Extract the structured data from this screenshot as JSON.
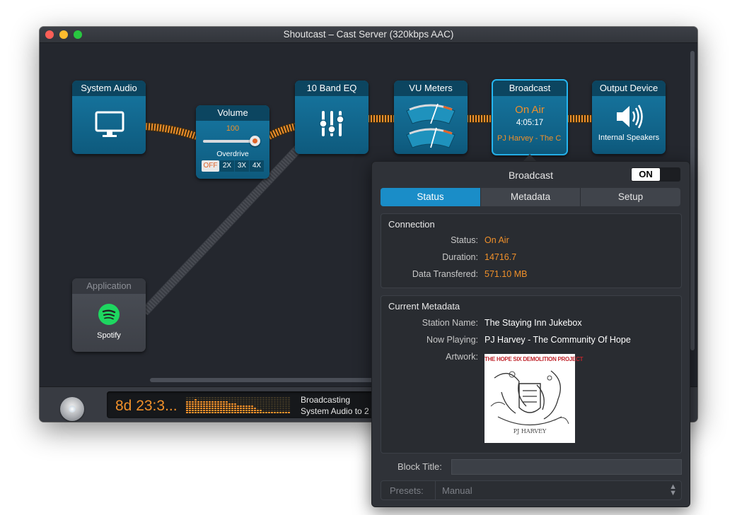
{
  "window": {
    "title": "Shoutcast – Cast Server (320kbps AAC)"
  },
  "nodes": {
    "system_audio": {
      "title": "System Audio"
    },
    "volume": {
      "title": "Volume",
      "value": "100",
      "overdrive_label": "Overdrive",
      "overdrive_options": [
        "OFF",
        "2X",
        "3X",
        "4X"
      ],
      "overdrive_selected": "OFF"
    },
    "eq": {
      "title": "10 Band EQ"
    },
    "vu": {
      "title": "VU Meters"
    },
    "broadcast": {
      "title": "Broadcast",
      "status": "On Air",
      "elapsed": "4:05:17",
      "track": "PJ Harvey - The C"
    },
    "output": {
      "title": "Output Device",
      "device": "Internal Speakers"
    },
    "application": {
      "title": "Application",
      "app_name": "Spotify"
    }
  },
  "bottom": {
    "time": "8d 23:3...",
    "status_line1": "Broadcasting",
    "status_line2": "System Audio to 2"
  },
  "popover": {
    "title": "Broadcast",
    "toggle": "ON",
    "tabs": [
      "Status",
      "Metadata",
      "Setup"
    ],
    "active_tab": "Status",
    "connection": {
      "title": "Connection",
      "status_label": "Status:",
      "status_value": "On Air",
      "duration_label": "Duration:",
      "duration_value": "14716.7",
      "data_label": "Data Transfered:",
      "data_value": "571.10 MB"
    },
    "metadata": {
      "title": "Current Metadata",
      "station_label": "Station Name:",
      "station_value": "The Staying Inn Jukebox",
      "playing_label": "Now Playing:",
      "playing_value": "PJ Harvey - The Community Of Hope",
      "artwork_label": "Artwork:",
      "artwork_text": "THE HOPE SIX DEMOLITION PROJECT",
      "artwork_signature": "PJ HARVEY"
    },
    "block_title_label": "Block Title:",
    "block_title_value": "",
    "presets_label": "Presets:",
    "presets_value": "Manual"
  },
  "colors": {
    "accent": "#1a8dc8",
    "orange": "#f0902a",
    "node_blue": "#1778a3",
    "window_bg": "#24272e"
  }
}
